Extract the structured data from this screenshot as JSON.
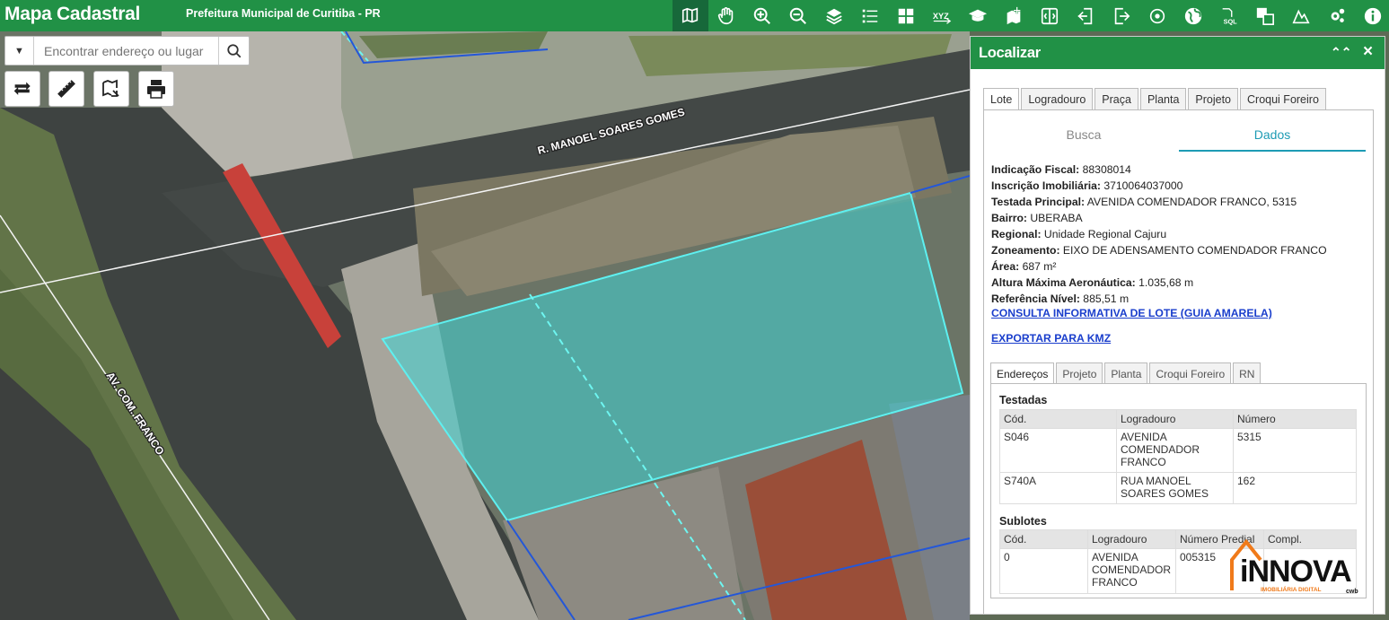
{
  "header": {
    "app_title": "Mapa Cadastral",
    "subtitle": "Prefeitura Municipal de Curitiba - PR",
    "tools": [
      "info-map-icon",
      "pan-icon",
      "zoom-in-icon",
      "zoom-out-icon",
      "layers-icon",
      "legend-list-icon",
      "grid-icon",
      "xyz-icon",
      "education-icon",
      "add-layer-icon",
      "split-view-icon",
      "import-icon",
      "export-icon",
      "locate-icon",
      "globe-icon",
      "sql-icon",
      "compare-icon",
      "measure-area-icon",
      "settings-icon",
      "info-icon"
    ],
    "xyz_text": "XYZ",
    "sql_text": "SQL"
  },
  "search": {
    "placeholder": "Encontrar endereço ou lugar"
  },
  "map": {
    "street_labels": [
      "R. MANOEL SOARES GOMES",
      "AV. COM. FRANCO"
    ],
    "map_buttons": [
      "swap-icon",
      "ruler-icon",
      "draw-icon",
      "print-icon"
    ]
  },
  "panel": {
    "title": "Localizar",
    "tabs": [
      "Lote",
      "Logradouro",
      "Praça",
      "Planta",
      "Projeto",
      "Croqui Foreiro"
    ],
    "subtabs": [
      "Busca",
      "Dados"
    ],
    "fields": [
      {
        "label": "Indicação Fiscal:",
        "value": "88308014"
      },
      {
        "label": "Inscrição Imobiliária:",
        "value": "3710064037000"
      },
      {
        "label": "Testada Principal:",
        "value": "AVENIDA COMENDADOR FRANCO, 5315"
      },
      {
        "label": "Bairro:",
        "value": "UBERABA"
      },
      {
        "label": "Regional:",
        "value": "Unidade Regional Cajuru"
      },
      {
        "label": "Zoneamento:",
        "value": "EIXO DE ADENSAMENTO COMENDADOR FRANCO"
      },
      {
        "label": "Área:",
        "value": "687 m²"
      },
      {
        "label": "Altura Máxima Aeronáutica:",
        "value": "1.035,68 m"
      },
      {
        "label": "Referência Nível:",
        "value": "885,51 m"
      }
    ],
    "link_consulta": "CONSULTA INFORMATIVA DE LOTE (GUIA AMARELA)",
    "link_kmz": "EXPORTAR PARA KMZ",
    "inner_tabs": [
      "Endereços",
      "Projeto",
      "Planta",
      "Croqui Foreiro",
      "RN"
    ],
    "testadas": {
      "title": "Testadas",
      "headers": [
        "Cód.",
        "Logradouro",
        "Número"
      ],
      "rows": [
        [
          "S046",
          "AVENIDA COMENDADOR FRANCO",
          "5315"
        ],
        [
          "S740A",
          "RUA MANOEL SOARES GOMES",
          "162"
        ]
      ]
    },
    "sublotes": {
      "title": "Sublotes",
      "headers": [
        "Cód.",
        "Logradouro",
        "Número Predial",
        "Compl."
      ],
      "rows": [
        [
          "0",
          "AVENIDA COMENDADOR FRANCO",
          "005315",
          ""
        ]
      ]
    }
  },
  "watermark": {
    "brand": "iNNOVA",
    "tagline": "IMOBILIÁRIA DIGITAL",
    "suffix": "cwb"
  },
  "colors": {
    "header_green": "#219146",
    "accent_teal": "#1d9bb4",
    "lot_fill": "#3fd6d6",
    "link_blue": "#1a3ecc",
    "logo_orange": "#f07a1a"
  }
}
